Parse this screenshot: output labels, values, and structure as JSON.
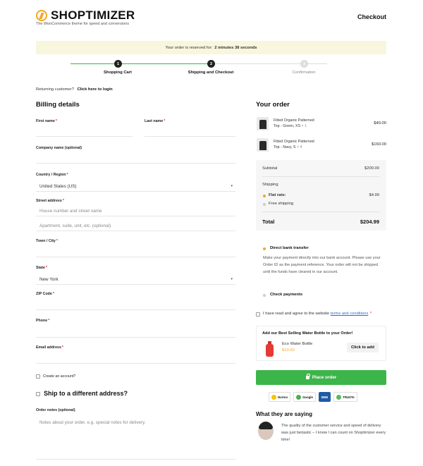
{
  "header": {
    "logo": "SHOPTIMIZER",
    "tagline": "The WooCommerce theme for speed and conversions",
    "page_title": "Checkout"
  },
  "reservation": {
    "label": "Your order is reserved for:",
    "time": "2 minutes 38 seconds"
  },
  "steps": [
    {
      "number": "1",
      "label": "Shopping Cart"
    },
    {
      "number": "2",
      "label": "Shipping and Checkout"
    },
    {
      "number": "3",
      "label": "Confirmation"
    }
  ],
  "returning": {
    "label": "Returning customer?",
    "link": "Click here to login"
  },
  "billing": {
    "title": "Billing details",
    "first_name": "First name",
    "last_name": "Last name",
    "company": "Company name (optional)",
    "country_label": "Country / Region",
    "country_value": "United States (US)",
    "street_label": "Street address",
    "street_placeholder": "House number and street name",
    "street2_placeholder": "Apartment, suite, unit, etc. (optional)",
    "town": "Town / City",
    "state_label": "State",
    "state_value": "New York",
    "zip": "ZIP Code",
    "phone": "Phone",
    "email": "Email address",
    "create_account": "Create an account?",
    "ship_different": "Ship to a different address?",
    "notes_label": "Order notes (optional)",
    "notes_placeholder": "Notes about your order, e.g. special notes for delivery.",
    "required_mark": "*"
  },
  "order": {
    "title": "Your order",
    "items": [
      {
        "name_line1": "Fitted Organic Patterned",
        "name_line2": "Top - Green, XS",
        "qty": "× 1",
        "price": "$40.00"
      },
      {
        "name_line1": "Fitted Organic Patterned",
        "name_line2": "Top - Navy, S",
        "qty": "× 4",
        "price": "$160.00"
      }
    ],
    "subtotal_label": "Subtotal",
    "subtotal_value": "$200.00",
    "shipping_label": "Shipping",
    "flat_rate_label": "Flat rate:",
    "flat_rate_value": "$4.99",
    "free_shipping_label": "Free shipping",
    "total_label": "Total",
    "total_value": "$204.99"
  },
  "payment": {
    "bank_title": "Direct bank transfer",
    "bank_desc": "Make your payment directly into our bank account. Please use your Order ID as the payment reference. Your order will not be shipped until the funds have cleared in our account.",
    "check_title": "Check payments",
    "terms_prefix": "I have read and agree to the website",
    "terms_link": "terms and conditions",
    "terms_required": "*"
  },
  "upsell": {
    "title": "Add our Best Selling Water Bottle to your Order!",
    "product": "Eco Water Bottle",
    "price": "$10.00",
    "button": "Click to add"
  },
  "place_order": "Place order",
  "badges": [
    "Norton",
    "Google",
    "BBB",
    "TRUSTe"
  ],
  "testimonial": {
    "title": "What they are saying",
    "quote": "The quality of the customer service and speed of delivery was just fantastic – I know I can count on Shoptimizer every time!"
  },
  "colors": {
    "accent": "#f5a623",
    "green": "#3cb54a",
    "reserve_bg": "#f8f6dc",
    "required": "#dd2222"
  }
}
